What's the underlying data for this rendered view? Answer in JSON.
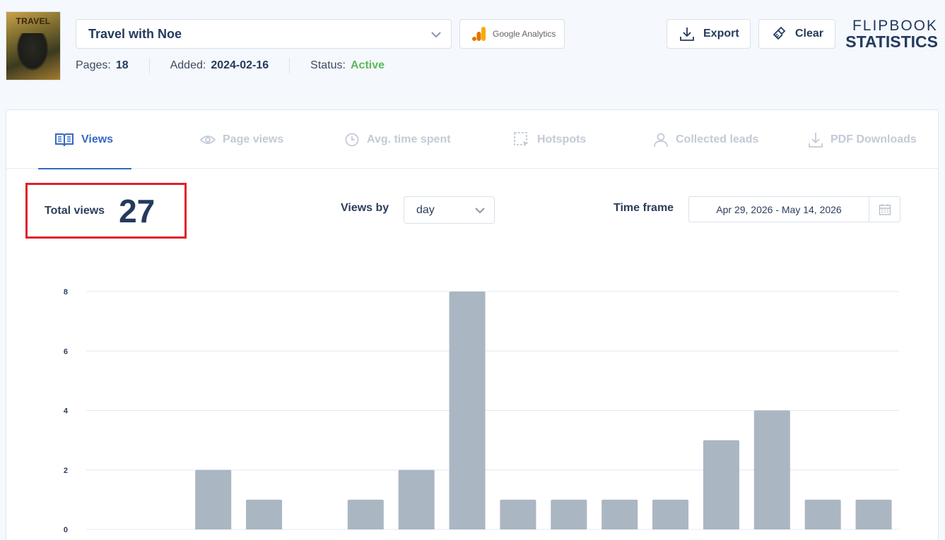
{
  "flipbook": {
    "cover_title": "TRAVEL",
    "name": "Travel with Noe",
    "pages_label": "Pages:",
    "pages": "18",
    "added_label": "Added:",
    "added": "2024-02-16",
    "status_label": "Status:",
    "status": "Active"
  },
  "google_analytics_label": "Google Analytics",
  "toolbar": {
    "export_label": "Export",
    "clear_label": "Clear"
  },
  "brand": {
    "line1": "FLIPBOOK",
    "line2": "STATISTICS"
  },
  "tabs": [
    {
      "label": "Views",
      "icon": "book-icon",
      "active": true
    },
    {
      "label": "Page views",
      "icon": "eye-icon",
      "active": false
    },
    {
      "label": "Avg. time spent",
      "icon": "clock-icon",
      "active": false
    },
    {
      "label": "Hotspots",
      "icon": "hotspot-icon",
      "active": false
    },
    {
      "label": "Collected leads",
      "icon": "user-icon",
      "active": false
    },
    {
      "label": "PDF Downloads",
      "icon": "download-icon",
      "active": false
    }
  ],
  "summary": {
    "total_label": "Total views",
    "total_value": "27"
  },
  "controls": {
    "views_by_label": "Views by",
    "views_by_value": "day",
    "timeframe_label": "Time frame",
    "date_range": "Apr 29, 2026 - May 14, 2026"
  },
  "colors": {
    "accent": "#3568c4",
    "active_status": "#5cb85c",
    "bar": "#abb6c3",
    "highlight": "#e0202a"
  },
  "chart_data": {
    "type": "bar",
    "values": [
      0,
      0,
      2,
      1,
      0,
      1,
      2,
      8,
      1,
      1,
      1,
      1,
      3,
      4,
      1,
      1
    ],
    "ylim": [
      0,
      8
    ],
    "y_ticks": [
      0,
      2,
      4,
      6,
      8
    ],
    "grid": true
  }
}
